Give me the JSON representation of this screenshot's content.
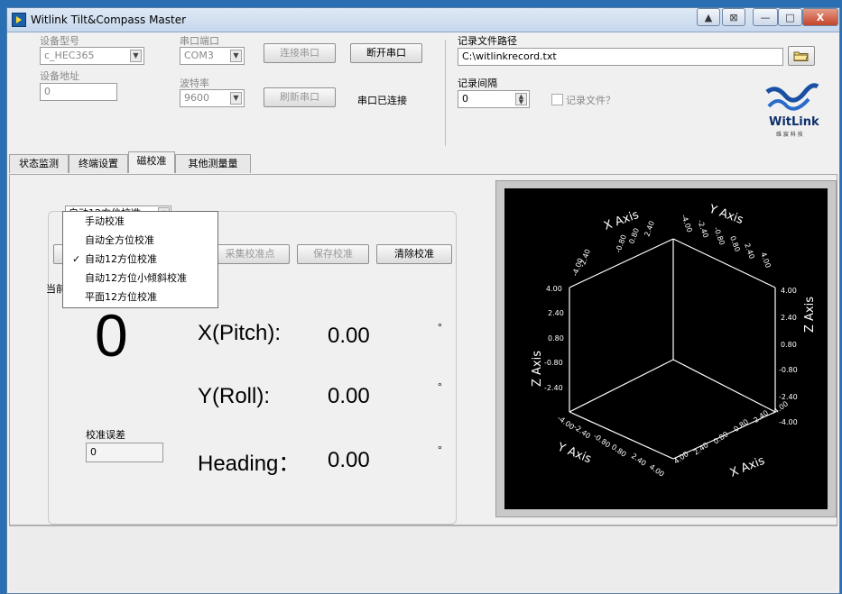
{
  "window": {
    "title": "Witlink Tilt&Compass Master",
    "controls": [
      "▲",
      "⊠",
      "—",
      "□",
      "X"
    ]
  },
  "device": {
    "model_label": "设备型号",
    "model_value": "c_HEC365",
    "address_label": "设备地址",
    "address_value": "0"
  },
  "serial": {
    "port_label": "串口端口",
    "port_value": "COM3",
    "baud_label": "波特率",
    "baud_value": "9600",
    "connect_btn": "连接串口",
    "disconnect_btn": "断开串口",
    "refresh_btn": "刷新串口",
    "status": "串口已连接"
  },
  "record": {
    "path_label": "记录文件路径",
    "path_value": "C:\\witlinkrecord.txt",
    "interval_label": "记录间隔",
    "interval_value": "0",
    "record_checkbox": "记录文件？"
  },
  "logo": {
    "text": "WitLink",
    "sub": "维 宸 科 技"
  },
  "tabs": [
    "状态监测",
    "终端设置",
    "磁校准",
    "其他测量量"
  ],
  "calibration": {
    "mode_selected": "自动12方位校准",
    "menu": [
      {
        "label": "手动校准",
        "checked": false
      },
      {
        "label": "自动全方位校准",
        "checked": false
      },
      {
        "label": "自动12方位校准",
        "checked": true
      },
      {
        "label": "自动12方位小倾斜校准",
        "checked": false
      },
      {
        "label": "平面12方位校准",
        "checked": false
      }
    ],
    "collect_btn": "采集校准点",
    "save_btn": "保存校准",
    "clear_btn": "清除校准",
    "current_label_partial": "当前",
    "count": "0",
    "error_label": "校准误差",
    "error_value": "0",
    "pitch_label": "X(Pitch):",
    "pitch_value": "0.00",
    "roll_label": "Y(Roll):",
    "roll_value": "0.00",
    "heading_label": "Heading：",
    "heading_value": "0.00",
    "degree": "°"
  },
  "cube": {
    "x_axis": "X Axis",
    "y_axis": "Y Axis",
    "z_axis": "Z Axis",
    "ticks": [
      "4.00",
      "2.40",
      "0.80",
      "-0.80",
      "-2.40",
      "-4.00"
    ]
  }
}
